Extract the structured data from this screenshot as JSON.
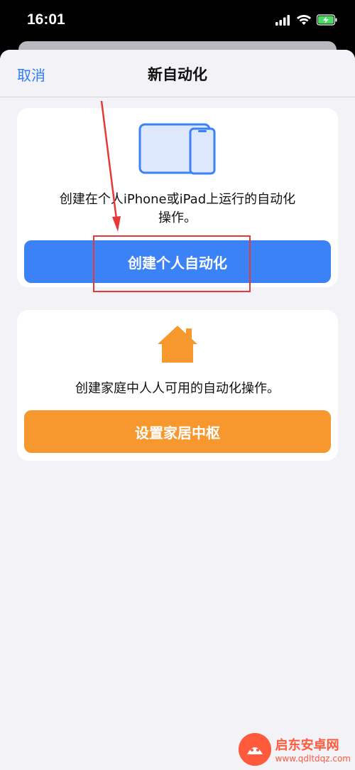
{
  "status_bar": {
    "time": "16:01",
    "icons": [
      "cellular-signal-icon",
      "wifi-icon",
      "battery-charging-icon"
    ]
  },
  "nav": {
    "cancel_label": "取消",
    "title": "新自动化"
  },
  "personal_card": {
    "icon": "iphone-ipad-icon",
    "description_line1": "创建在个人iPhone或iPad上运行的自动化",
    "description_line2": "操作。",
    "button_label": "创建个人自动化"
  },
  "home_card": {
    "icon": "house-icon",
    "description": "创建家庭中人人可用的自动化操作。",
    "button_label": "设置家居中枢"
  },
  "watermark": {
    "title": "启东安卓网",
    "url": "www.qdltdqz.com"
  },
  "colors": {
    "accent_blue": "#3a82f6",
    "accent_orange": "#f7982e",
    "link_blue": "#2d7cf6",
    "annotation_red": "#e53935",
    "background": "#f2f2f7"
  }
}
